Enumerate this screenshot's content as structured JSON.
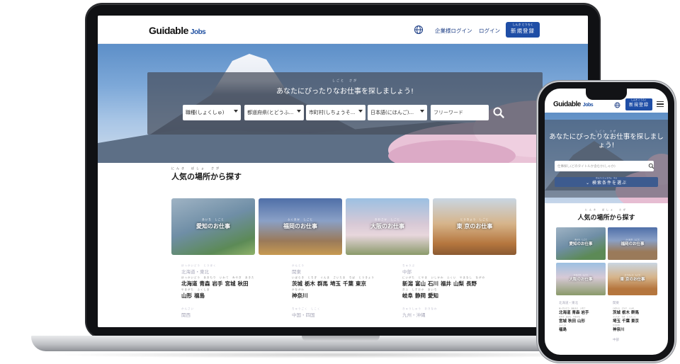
{
  "colors": {
    "brand_blue": "#1f4ea6",
    "link_blue": "#1e3f86",
    "panel_overlay": "#464e5c"
  },
  "laptop": {
    "header": {
      "logo_main": "Guidable",
      "logo_sub": "Jobs",
      "globe_icon": "globe-icon",
      "company_login": "企業様ログイン",
      "login": "ログイン",
      "register_ruby": "しんき とうろく",
      "register": "新規登録"
    },
    "hero": {
      "title_ruby": "しごと　さが",
      "title": "あなたにぴったりなお仕事を探しましょう!",
      "selects": [
        {
          "label": "職種(しょくしゅ)"
        },
        {
          "label": "都道府県(とどうふ..."
        },
        {
          "label": "市町村(しちょうそ..."
        },
        {
          "label": "日本語(にほんご)..."
        }
      ],
      "free_word": "フリーワード",
      "search_icon": "search-icon"
    },
    "popular": {
      "title_ruby": "にんき　ばしょ　さが",
      "title": "人気の場所から探す",
      "cards": [
        {
          "ruby": "あいち　しごと",
          "label": "愛知のお仕事"
        },
        {
          "ruby": "ふくおか　しごと",
          "label": "福岡のお仕事"
        },
        {
          "ruby": "おおさか　しごと",
          "label": "大阪のお仕事"
        },
        {
          "ruby": "とうきょう　しごと",
          "label": "東 京のお仕事"
        }
      ],
      "regions": [
        {
          "ruby": "ほっかいどう　とうほく",
          "name": "北海道・東北",
          "rows": [
            {
              "ruby": "ほっかいどう　あおもり　いわて　みやぎ　あきた",
              "prefs": [
                "北海道",
                "青森",
                "岩手",
                "宮城",
                "秋田"
              ]
            },
            {
              "ruby": "やまがた　ふくしま",
              "prefs": [
                "山形",
                "福島"
              ]
            }
          ]
        },
        {
          "ruby": "かんとう",
          "name": "関東",
          "rows": [
            {
              "ruby": "いばらき　とちぎ　ぐんま　さいたま　ちば　とうきょう",
              "prefs": [
                "茨城",
                "栃木",
                "群馬",
                "埼玉",
                "千葉",
                "東京"
              ]
            },
            {
              "ruby": "かながわ",
              "prefs": [
                "神奈川"
              ]
            }
          ]
        },
        {
          "ruby": "ちゅうぶ",
          "name": "中部",
          "rows": [
            {
              "ruby": "にいがた　とやま　いしかわ　ふくい　やまなし　ながの",
              "prefs": [
                "新潟",
                "富山",
                "石川",
                "福井",
                "山梨",
                "長野"
              ]
            },
            {
              "ruby": "ぎふ　しずおか　あいち",
              "prefs": [
                "岐阜",
                "静岡",
                "愛知"
              ]
            }
          ]
        }
      ],
      "more_regions": [
        {
          "ruby": "かんさい",
          "name": "関西"
        },
        {
          "ruby": "ちゅうごく　しこく",
          "name": "中国・四国"
        },
        {
          "ruby": "きゅうしゅう　おきなわ",
          "name": "九州・沖縄"
        }
      ]
    }
  },
  "phone": {
    "header": {
      "logo_main": "Guidable",
      "logo_sub": "Jobs",
      "register_ruby": "しんき とうろく",
      "register": "新規登録",
      "menu_icon": "hamburger-icon"
    },
    "hero": {
      "title_ruby": "しごと　さが",
      "title": "あなたにぴったりなお仕事を探しましょう!",
      "input_placeholder": "仕事探し(どのタイトルか含むか(しゃか)",
      "cond_ruby": "けんさくじょうけん　えら",
      "cond": "検索条件を選ぶ"
    },
    "popular": {
      "title_ruby": "にんき　ばしょ　さが",
      "title": "人気の場所から探す",
      "cards": [
        {
          "ruby": "あいち　しごと",
          "label": "愛知のお仕事"
        },
        {
          "ruby": "ふくおか　しごと",
          "label": "福岡のお仕事"
        },
        {
          "ruby": "おおさか　しごと",
          "label": "大阪のお仕事"
        },
        {
          "ruby": "とうきょう　しごと",
          "label": "東 京のお仕事"
        }
      ],
      "region1": "北海道・東北",
      "region1_rows": [
        {
          "ruby": "ほっかいどう　あおもり　いわて",
          "prefs": [
            "北海道",
            "青森",
            "岩手"
          ]
        },
        {
          "ruby": "みやぎ　あきた　やまがた",
          "prefs": [
            "宮城",
            "秋田",
            "山形"
          ]
        },
        {
          "ruby": "ふくしま",
          "prefs": [
            "福島"
          ]
        }
      ],
      "region2": "関東",
      "region2_rows": [
        {
          "ruby": "いばらき　とちぎ　ぐんま",
          "prefs": [
            "茨城",
            "栃木",
            "群馬"
          ]
        },
        {
          "ruby": "さいたま　ちば　とうきょう",
          "prefs": [
            "埼玉",
            "千葉",
            "東京"
          ]
        },
        {
          "ruby": "かながわ",
          "prefs": [
            "神奈川"
          ]
        }
      ],
      "region3": "中部"
    }
  }
}
